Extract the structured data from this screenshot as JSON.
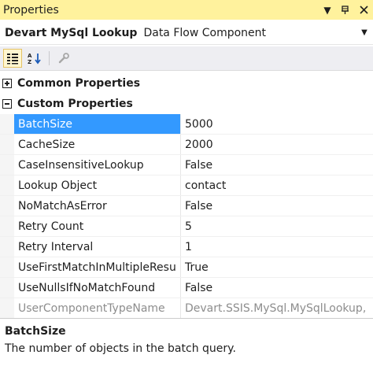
{
  "window": {
    "title": "Properties",
    "icons": {
      "dropdown": "chevron-down-icon",
      "pin": "pin-icon",
      "close": "close-icon"
    }
  },
  "object_selector": {
    "name": "Devart MySql Lookup",
    "type": "Data Flow Component"
  },
  "toolbar": {
    "buttons": [
      "categorized-icon",
      "alphabetical-icon",
      "property-pages-icon"
    ],
    "categorized_active": true
  },
  "categories": [
    {
      "label": "Common Properties",
      "expanded": false
    },
    {
      "label": "Custom Properties",
      "expanded": true
    }
  ],
  "properties": [
    {
      "name": "BatchSize",
      "value": "5000",
      "selected": true
    },
    {
      "name": "CacheSize",
      "value": "2000"
    },
    {
      "name": "CaseInsensitiveLookup",
      "value": "False"
    },
    {
      "name": "Lookup Object",
      "value": "contact"
    },
    {
      "name": "NoMatchAsError",
      "value": "False"
    },
    {
      "name": "Retry Count",
      "value": "5"
    },
    {
      "name": "Retry Interval",
      "value": "1"
    },
    {
      "name": "UseFirstMatchInMultipleResu",
      "value": "True"
    },
    {
      "name": "UseNullsIfNoMatchFound",
      "value": "False"
    },
    {
      "name": "UserComponentTypeName",
      "value": "Devart.SSIS.MySql.MySqlLookup,",
      "readonly": true
    }
  ],
  "description": {
    "title": "BatchSize",
    "text": "The number of objects in the batch query."
  },
  "colors": {
    "title_bar": "#fff29d",
    "selection": "#3399ff",
    "toolbar": "#eeeef2",
    "readonly_text": "#8d8d8d"
  }
}
